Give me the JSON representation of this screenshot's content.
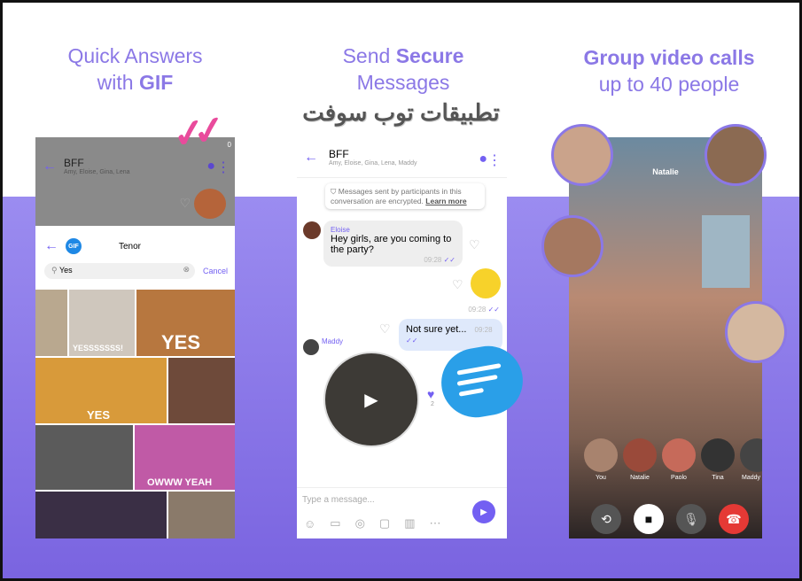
{
  "panels": [
    {
      "heading_line1": "Quick Answers",
      "heading_line2_prefix": "with ",
      "heading_line2_bold": "GIF"
    },
    {
      "heading_line1_prefix": "Send ",
      "heading_line1_bold": "Secure",
      "heading_line2": "Messages"
    },
    {
      "heading_line1_bold": "Group video calls",
      "heading_line2": "up to 40 people"
    }
  ],
  "watermark": "تطبيقات توب سوفت",
  "left_phone": {
    "chat_title": "BFF",
    "chat_members": "Amy, Eloise, Gina, Lena",
    "badge": "0",
    "gif_provider_badge": "GIF",
    "gif_provider": "Tenor",
    "search_value": "Yes",
    "cancel_label": "Cancel",
    "gif_captions": [
      "YESSSSSSS!",
      "YES",
      "YES",
      "OWWW YEAH"
    ]
  },
  "middle_phone": {
    "chat_title": "BFF",
    "chat_members": "Amy, Eloise, Gina, Lena, Maddy",
    "encryption_notice": "Messages sent by participants in this conversation are encrypted.",
    "learn_more": "Learn more",
    "messages": [
      {
        "sender": "Eloise",
        "text": "Hey girls, are you coming to the party?",
        "time": "09:28"
      },
      {
        "sender": "",
        "text": "",
        "time": "09:28"
      },
      {
        "sender": "",
        "text": "Not sure yet...",
        "time": "09:28"
      },
      {
        "sender": "Maddy",
        "text": "",
        "time": ""
      }
    ],
    "like_count": "2",
    "input_placeholder": "Type a message..."
  },
  "right_phone": {
    "caller_name": "Natalie",
    "participants": [
      "You",
      "Natalie",
      "Paolo",
      "Tina",
      "Maddy"
    ],
    "end_call_color": "#e53935"
  },
  "brand_color": "#7360f2"
}
